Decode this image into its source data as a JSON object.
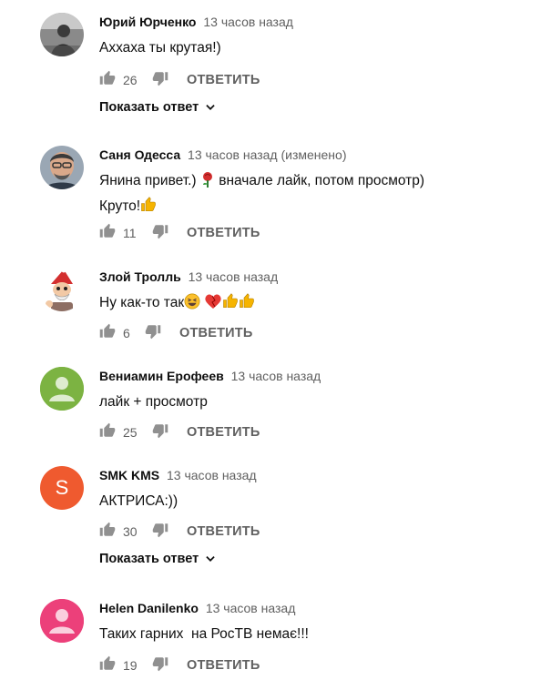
{
  "comments": [
    {
      "author": "Юрий Юрченко",
      "time": "13 часов назад",
      "text_lines": [
        "Аххаха ты крутая!)"
      ],
      "likes": "26",
      "reply": "ОТВЕТИТЬ",
      "show_replies": "Показать ответ",
      "avatar_icon": "photo-avatar-dark"
    },
    {
      "author": "Саня Одесса",
      "time": "13 часов назад (изменено)",
      "text_lines": [
        "Янина привет.)",
        "вначале лайк, потом просмотр)",
        "Круто!"
      ],
      "likes": "11",
      "reply": "ОТВЕТИТЬ",
      "avatar_icon": "photo-avatar-man"
    },
    {
      "author": "Злой Тролль",
      "time": "13 часов назад",
      "text_lines": [
        "Ну как-то так"
      ],
      "likes": "6",
      "reply": "ОТВЕТИТЬ",
      "avatar_icon": "gnome-avatar"
    },
    {
      "author": "Вениамин Ерофеев",
      "time": "13 часов назад",
      "text_lines": [
        "лайк + просмотр"
      ],
      "likes": "25",
      "reply": "ОТВЕТИТЬ",
      "avatar_icon": "default-user-avatar",
      "avatar_color": "#7cb342"
    },
    {
      "author": "SMK KMS",
      "time": "13 часов назад",
      "text_lines": [
        "АКТРИСА:))"
      ],
      "likes": "30",
      "reply": "ОТВЕТИТЬ",
      "show_replies": "Показать ответ",
      "avatar_letter": "S",
      "avatar_color": "#ef5a2f"
    },
    {
      "author": "Helen Danilenko",
      "time": "13 часов назад",
      "text_lines": [
        "Таких гарних  на РосТВ немає!!!"
      ],
      "likes": "19",
      "reply": "ОТВЕТИТЬ",
      "avatar_icon": "default-user-avatar",
      "avatar_color": "#ec407a"
    }
  ]
}
